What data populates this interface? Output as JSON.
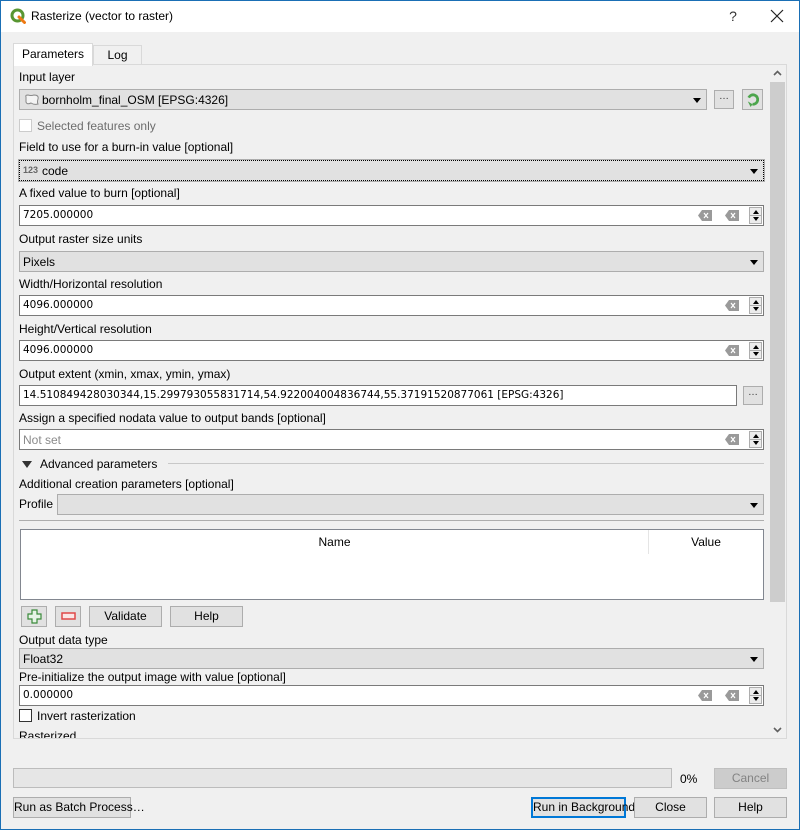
{
  "window": {
    "title": "Rasterize (vector to raster)",
    "help_label": "?",
    "close_label": "×"
  },
  "tabs": [
    {
      "label": "Parameters",
      "active": true
    },
    {
      "label": "Log",
      "active": false
    }
  ],
  "params": {
    "input_layer": {
      "label": "Input layer",
      "value": "bornholm_final_OSM [EPSG:4326]",
      "browse_label": "…",
      "icon": "polygon-layer-icon"
    },
    "selected_only": {
      "label": "Selected features only",
      "checked": false,
      "enabled": false
    },
    "burn_field": {
      "label": "Field to use for a burn-in value [optional]",
      "type_badge": "123",
      "value": "code"
    },
    "burn_value": {
      "label": "A fixed value to burn [optional]",
      "value": "7205.000000"
    },
    "size_units": {
      "label": "Output raster size units",
      "value": "Pixels"
    },
    "width": {
      "label": "Width/Horizontal resolution",
      "value": "4096.000000"
    },
    "height": {
      "label": "Height/Vertical resolution",
      "value": "4096.000000"
    },
    "extent": {
      "label": "Output extent (xmin, xmax, ymin, ymax)",
      "value": "14.510849428030344,15.299793055831714,54.922004004836744,55.37191520877061 [EPSG:4326]",
      "browse_label": "…"
    },
    "nodata": {
      "label": "Assign a specified nodata value to output bands [optional]",
      "placeholder": "Not set"
    },
    "advanced": {
      "title": "Advanced parameters",
      "expanded": true,
      "creation_label": "Additional creation parameters [optional]",
      "profile_label": "Profile",
      "profile_value": "",
      "table_headers": [
        "Name",
        "Value"
      ],
      "validate_label": "Validate",
      "help_label": "Help"
    },
    "data_type": {
      "label": "Output data type",
      "value": "Float32"
    },
    "init_value": {
      "label": "Pre-initialize the output image with value [optional]",
      "value": "0.000000"
    },
    "invert": {
      "label": "Invert rasterization",
      "checked": false
    },
    "rasterized": {
      "label": "Rasterized"
    }
  },
  "footer": {
    "progress_percent": 0,
    "progress_text": "0%",
    "cancel_label": "Cancel",
    "batch_label": "Run as Batch Process…",
    "run_bg_label": "Run in Background",
    "close_label": "Close",
    "help_label": "Help"
  },
  "colors": {
    "accent": "#0078d7",
    "window_border": "#1a6fb5",
    "add_green": "#3a8a3a",
    "remove_red": "#e04848",
    "qgis_green": "#589632",
    "qgis_yellow": "#ee7913"
  }
}
